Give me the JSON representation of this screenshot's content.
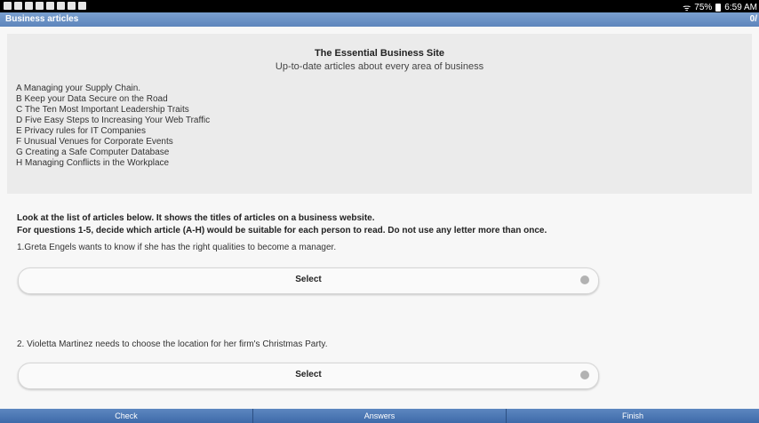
{
  "status": {
    "battery": "75%",
    "time": "6:59 AM"
  },
  "header": {
    "title": "Business articles",
    "counter": "0/"
  },
  "site": {
    "title": "The Essential Business Site",
    "subtitle": "Up-to-date articles about every area of business"
  },
  "articles": [
    "A Managing your Supply Chain.",
    "B Keep your Data Secure on the Road",
    "C The Ten Most Important Leadership Traits",
    "D Five Easy Steps to Increasing Your Web Traffic",
    "E Privacy rules for IT Companies",
    "F Unusual Venues for Corporate Events",
    "G Creating a Safe Computer Database",
    "H Managing Conflicts in the Workplace"
  ],
  "instructions": {
    "line1": "Look at the list of articles below. It shows the titles of articles on a business website.",
    "line2": "For questions 1-5, decide which article (A-H) would be suitable for each person to read. Do not use any letter more than once."
  },
  "questions": [
    {
      "text": "1.Greta Engels wants to know if she has the right qualities to become a manager.",
      "select_label": "Select"
    },
    {
      "text": "2. Violetta Martinez needs to choose the location for her firm's Christmas Party.",
      "select_label": "Select"
    }
  ],
  "footer": {
    "check": "Check",
    "answers": "Answers",
    "finish": "Finish"
  }
}
